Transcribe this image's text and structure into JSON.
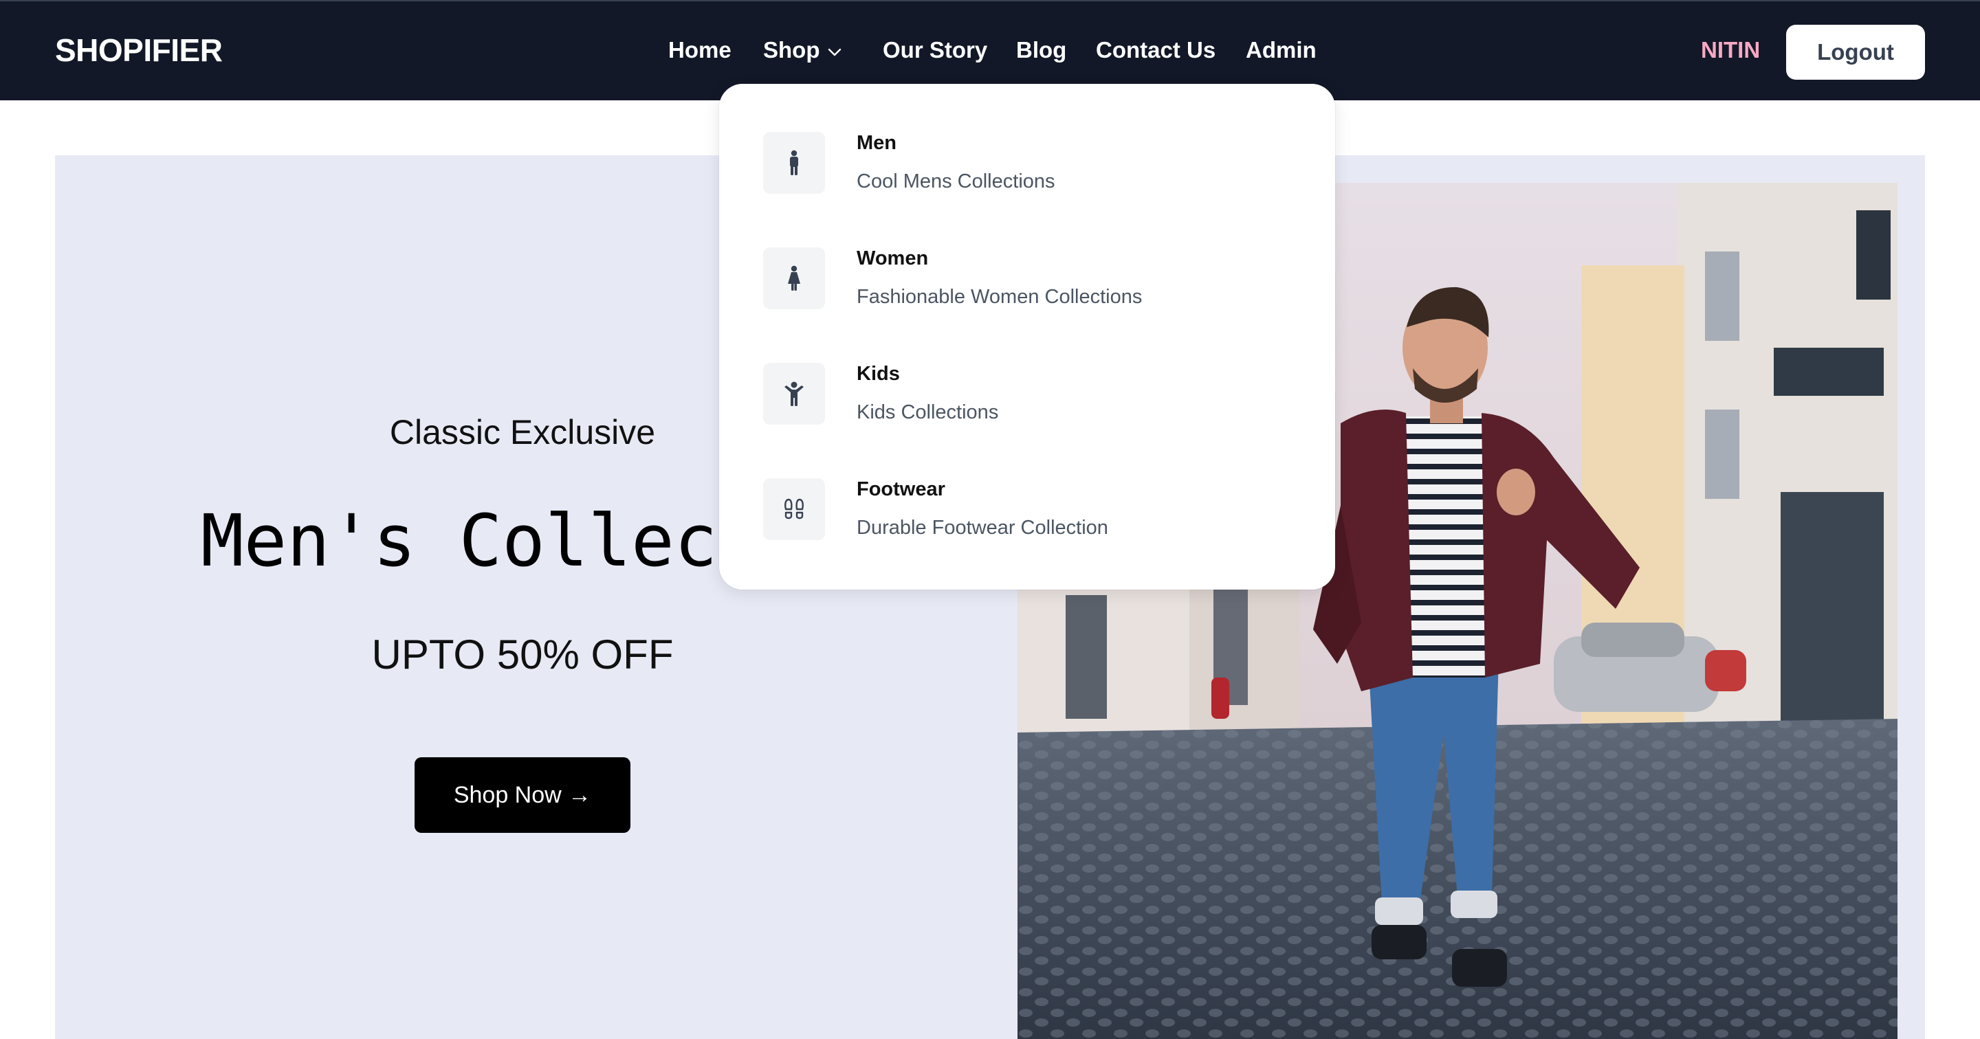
{
  "navbar": {
    "brand": "SHOPIFIER",
    "links": [
      "Home",
      "Shop",
      "Our Story",
      "Blog",
      "Contact Us",
      "Admin"
    ],
    "user_name": "NITIN",
    "logout_label": "Logout"
  },
  "hero": {
    "subtitle": "Classic Exclusive",
    "title": "Men's Collect",
    "offer": "UPTO 50% OFF",
    "cta_label": "Shop Now →"
  },
  "shop_dropdown": {
    "items": [
      {
        "title": "Men",
        "description": "Cool Mens Collections",
        "icon": "man-icon"
      },
      {
        "title": "Women",
        "description": "Fashionable Women Collections",
        "icon": "woman-icon"
      },
      {
        "title": "Kids",
        "description": "Kids Collections",
        "icon": "child-icon"
      },
      {
        "title": "Footwear",
        "description": "Durable Footwear Collection",
        "icon": "footprints-icon"
      }
    ]
  },
  "colors": {
    "navbar_bg": "#121827",
    "user_name": "#f9a8c4",
    "hero_bg": "#e7eaf5",
    "cta_bg": "#000000"
  }
}
